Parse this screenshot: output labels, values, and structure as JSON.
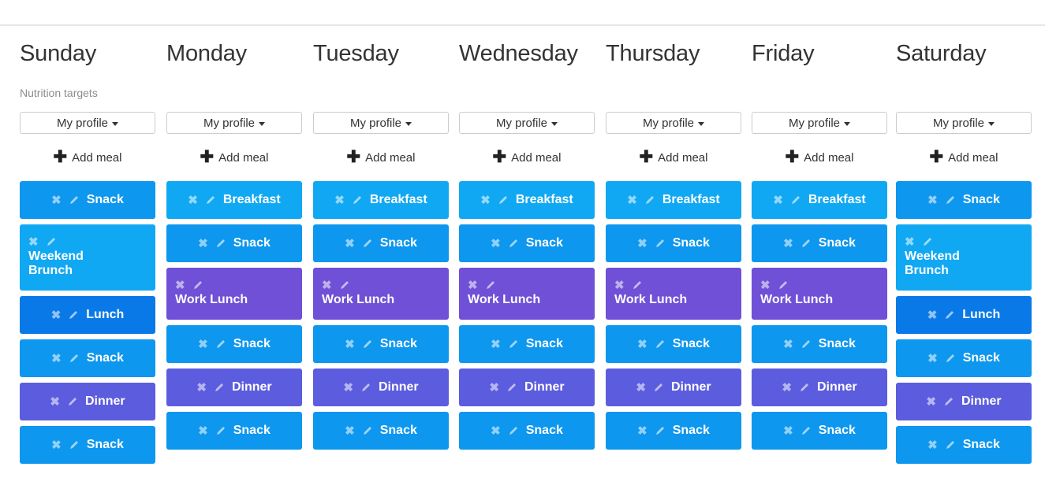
{
  "days": [
    {
      "name": "Sunday",
      "nutrition_targets_label": "Nutrition targets",
      "profile_label": "My profile",
      "add_meal_label": "Add meal",
      "meals": [
        {
          "title": "Snack",
          "color": "#0d97ee"
        },
        {
          "title": "Weekend Brunch",
          "color": "#11a8f3"
        },
        {
          "title": "Lunch",
          "color": "#0a79e8"
        },
        {
          "title": "Snack",
          "color": "#0d97ee"
        },
        {
          "title": "Dinner",
          "color": "#5c5cdf"
        },
        {
          "title": "Snack",
          "color": "#0d97ee"
        }
      ]
    },
    {
      "name": "Monday",
      "profile_label": "My profile",
      "add_meal_label": "Add meal",
      "meals": [
        {
          "title": "Breakfast",
          "color": "#11a8f3"
        },
        {
          "title": "Snack",
          "color": "#0d97ee"
        },
        {
          "title": "Work Lunch",
          "color": "#6f50d6"
        },
        {
          "title": "Snack",
          "color": "#0d97ee"
        },
        {
          "title": "Dinner",
          "color": "#5c5cdf"
        },
        {
          "title": "Snack",
          "color": "#0d97ee"
        }
      ]
    },
    {
      "name": "Tuesday",
      "profile_label": "My profile",
      "add_meal_label": "Add meal",
      "meals": [
        {
          "title": "Breakfast",
          "color": "#11a8f3"
        },
        {
          "title": "Snack",
          "color": "#0d97ee"
        },
        {
          "title": "Work Lunch",
          "color": "#6f50d6"
        },
        {
          "title": "Snack",
          "color": "#0d97ee"
        },
        {
          "title": "Dinner",
          "color": "#5c5cdf"
        },
        {
          "title": "Snack",
          "color": "#0d97ee"
        }
      ]
    },
    {
      "name": "Wednesday",
      "profile_label": "My profile",
      "add_meal_label": "Add meal",
      "meals": [
        {
          "title": "Breakfast",
          "color": "#11a8f3"
        },
        {
          "title": "Snack",
          "color": "#0d97ee"
        },
        {
          "title": "Work Lunch",
          "color": "#6f50d6"
        },
        {
          "title": "Snack",
          "color": "#0d97ee"
        },
        {
          "title": "Dinner",
          "color": "#5c5cdf"
        },
        {
          "title": "Snack",
          "color": "#0d97ee"
        }
      ]
    },
    {
      "name": "Thursday",
      "profile_label": "My profile",
      "add_meal_label": "Add meal",
      "meals": [
        {
          "title": "Breakfast",
          "color": "#11a8f3"
        },
        {
          "title": "Snack",
          "color": "#0d97ee"
        },
        {
          "title": "Work Lunch",
          "color": "#6f50d6"
        },
        {
          "title": "Snack",
          "color": "#0d97ee"
        },
        {
          "title": "Dinner",
          "color": "#5c5cdf"
        },
        {
          "title": "Snack",
          "color": "#0d97ee"
        }
      ]
    },
    {
      "name": "Friday",
      "profile_label": "My profile",
      "add_meal_label": "Add meal",
      "meals": [
        {
          "title": "Breakfast",
          "color": "#11a8f3"
        },
        {
          "title": "Snack",
          "color": "#0d97ee"
        },
        {
          "title": "Work Lunch",
          "color": "#6f50d6"
        },
        {
          "title": "Snack",
          "color": "#0d97ee"
        },
        {
          "title": "Dinner",
          "color": "#5c5cdf"
        },
        {
          "title": "Snack",
          "color": "#0d97ee"
        }
      ]
    },
    {
      "name": "Saturday",
      "profile_label": "My profile",
      "add_meal_label": "Add meal",
      "meals": [
        {
          "title": "Snack",
          "color": "#0d97ee"
        },
        {
          "title": "Weekend Brunch",
          "color": "#11a8f3"
        },
        {
          "title": "Lunch",
          "color": "#0a79e8"
        },
        {
          "title": "Snack",
          "color": "#0d97ee"
        },
        {
          "title": "Dinner",
          "color": "#5c5cdf"
        },
        {
          "title": "Snack",
          "color": "#0d97ee"
        }
      ]
    }
  ],
  "icons": {
    "add": "plus-icon",
    "remove": "x-icon",
    "edit": "pencil-icon",
    "dropdown": "caret-down-icon"
  }
}
